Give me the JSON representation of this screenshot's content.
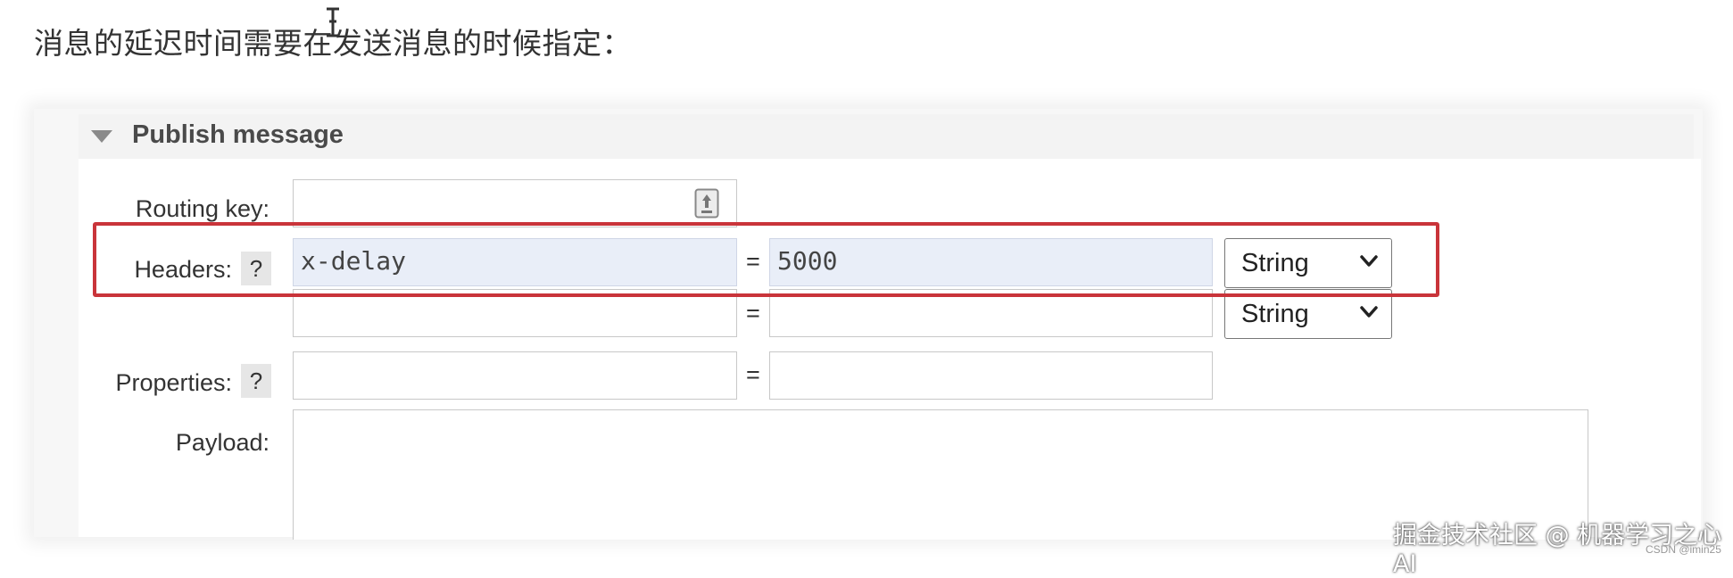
{
  "intro_text": "消息的延迟时间需要在发送消息的时候指定：",
  "panel": {
    "title": "Publish message",
    "routing_key": {
      "label": "Routing key:",
      "value": ""
    },
    "headers": {
      "label": "Headers:",
      "help": "?",
      "rows": [
        {
          "key": "x-delay",
          "equals": "=",
          "value": "5000",
          "type": "String"
        },
        {
          "key": "",
          "equals": "=",
          "value": "",
          "type": "String"
        }
      ]
    },
    "properties": {
      "label": "Properties:",
      "help": "?",
      "key": "",
      "equals": "=",
      "value": ""
    },
    "payload": {
      "label": "Payload:",
      "value": ""
    }
  },
  "icons": {
    "collapse": "triangle-down-icon",
    "upload": "upload-icon",
    "dropdown": "chevron-down-icon",
    "text_cursor": "text-cursor-icon"
  },
  "colors": {
    "highlight_border": "#c9343a",
    "filled_input_bg": "#e9eef8"
  },
  "watermark": {
    "main": "掘金技术社区 @ 机器学习之心AI",
    "sub": "CSDN @imin25"
  }
}
